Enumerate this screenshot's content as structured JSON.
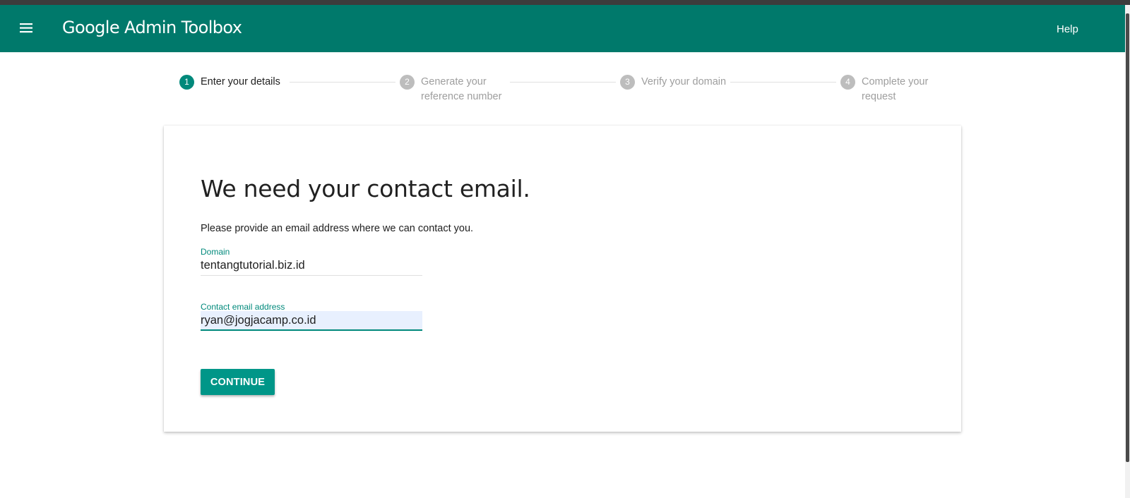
{
  "appbar": {
    "title": "Google Admin Toolbox",
    "help_label": "Help",
    "menu_icon": "hamburger-menu-icon",
    "color": "#00796b"
  },
  "stepper": {
    "steps": [
      {
        "number": "1",
        "label": "Enter your details",
        "active": true
      },
      {
        "number": "2",
        "label_line1": "Generate your",
        "label_line2": "reference number",
        "active": false
      },
      {
        "number": "3",
        "label": "Verify your domain",
        "active": false
      },
      {
        "number": "4",
        "label_line1": "Complete your",
        "label_line2": "request",
        "active": false
      }
    ]
  },
  "card": {
    "heading": "We need your contact email.",
    "description": "Please provide an email address where we can contact you.",
    "domain_field": {
      "label": "Domain",
      "value": "tentangtutorial.biz.id"
    },
    "email_field": {
      "label": "Contact email address",
      "value": "ryan@jogjacamp.co.id"
    },
    "continue_label": "CONTINUE"
  },
  "colors": {
    "accent": "#009688",
    "step_active": "#00897b",
    "step_inactive": "#bdbdbd"
  }
}
